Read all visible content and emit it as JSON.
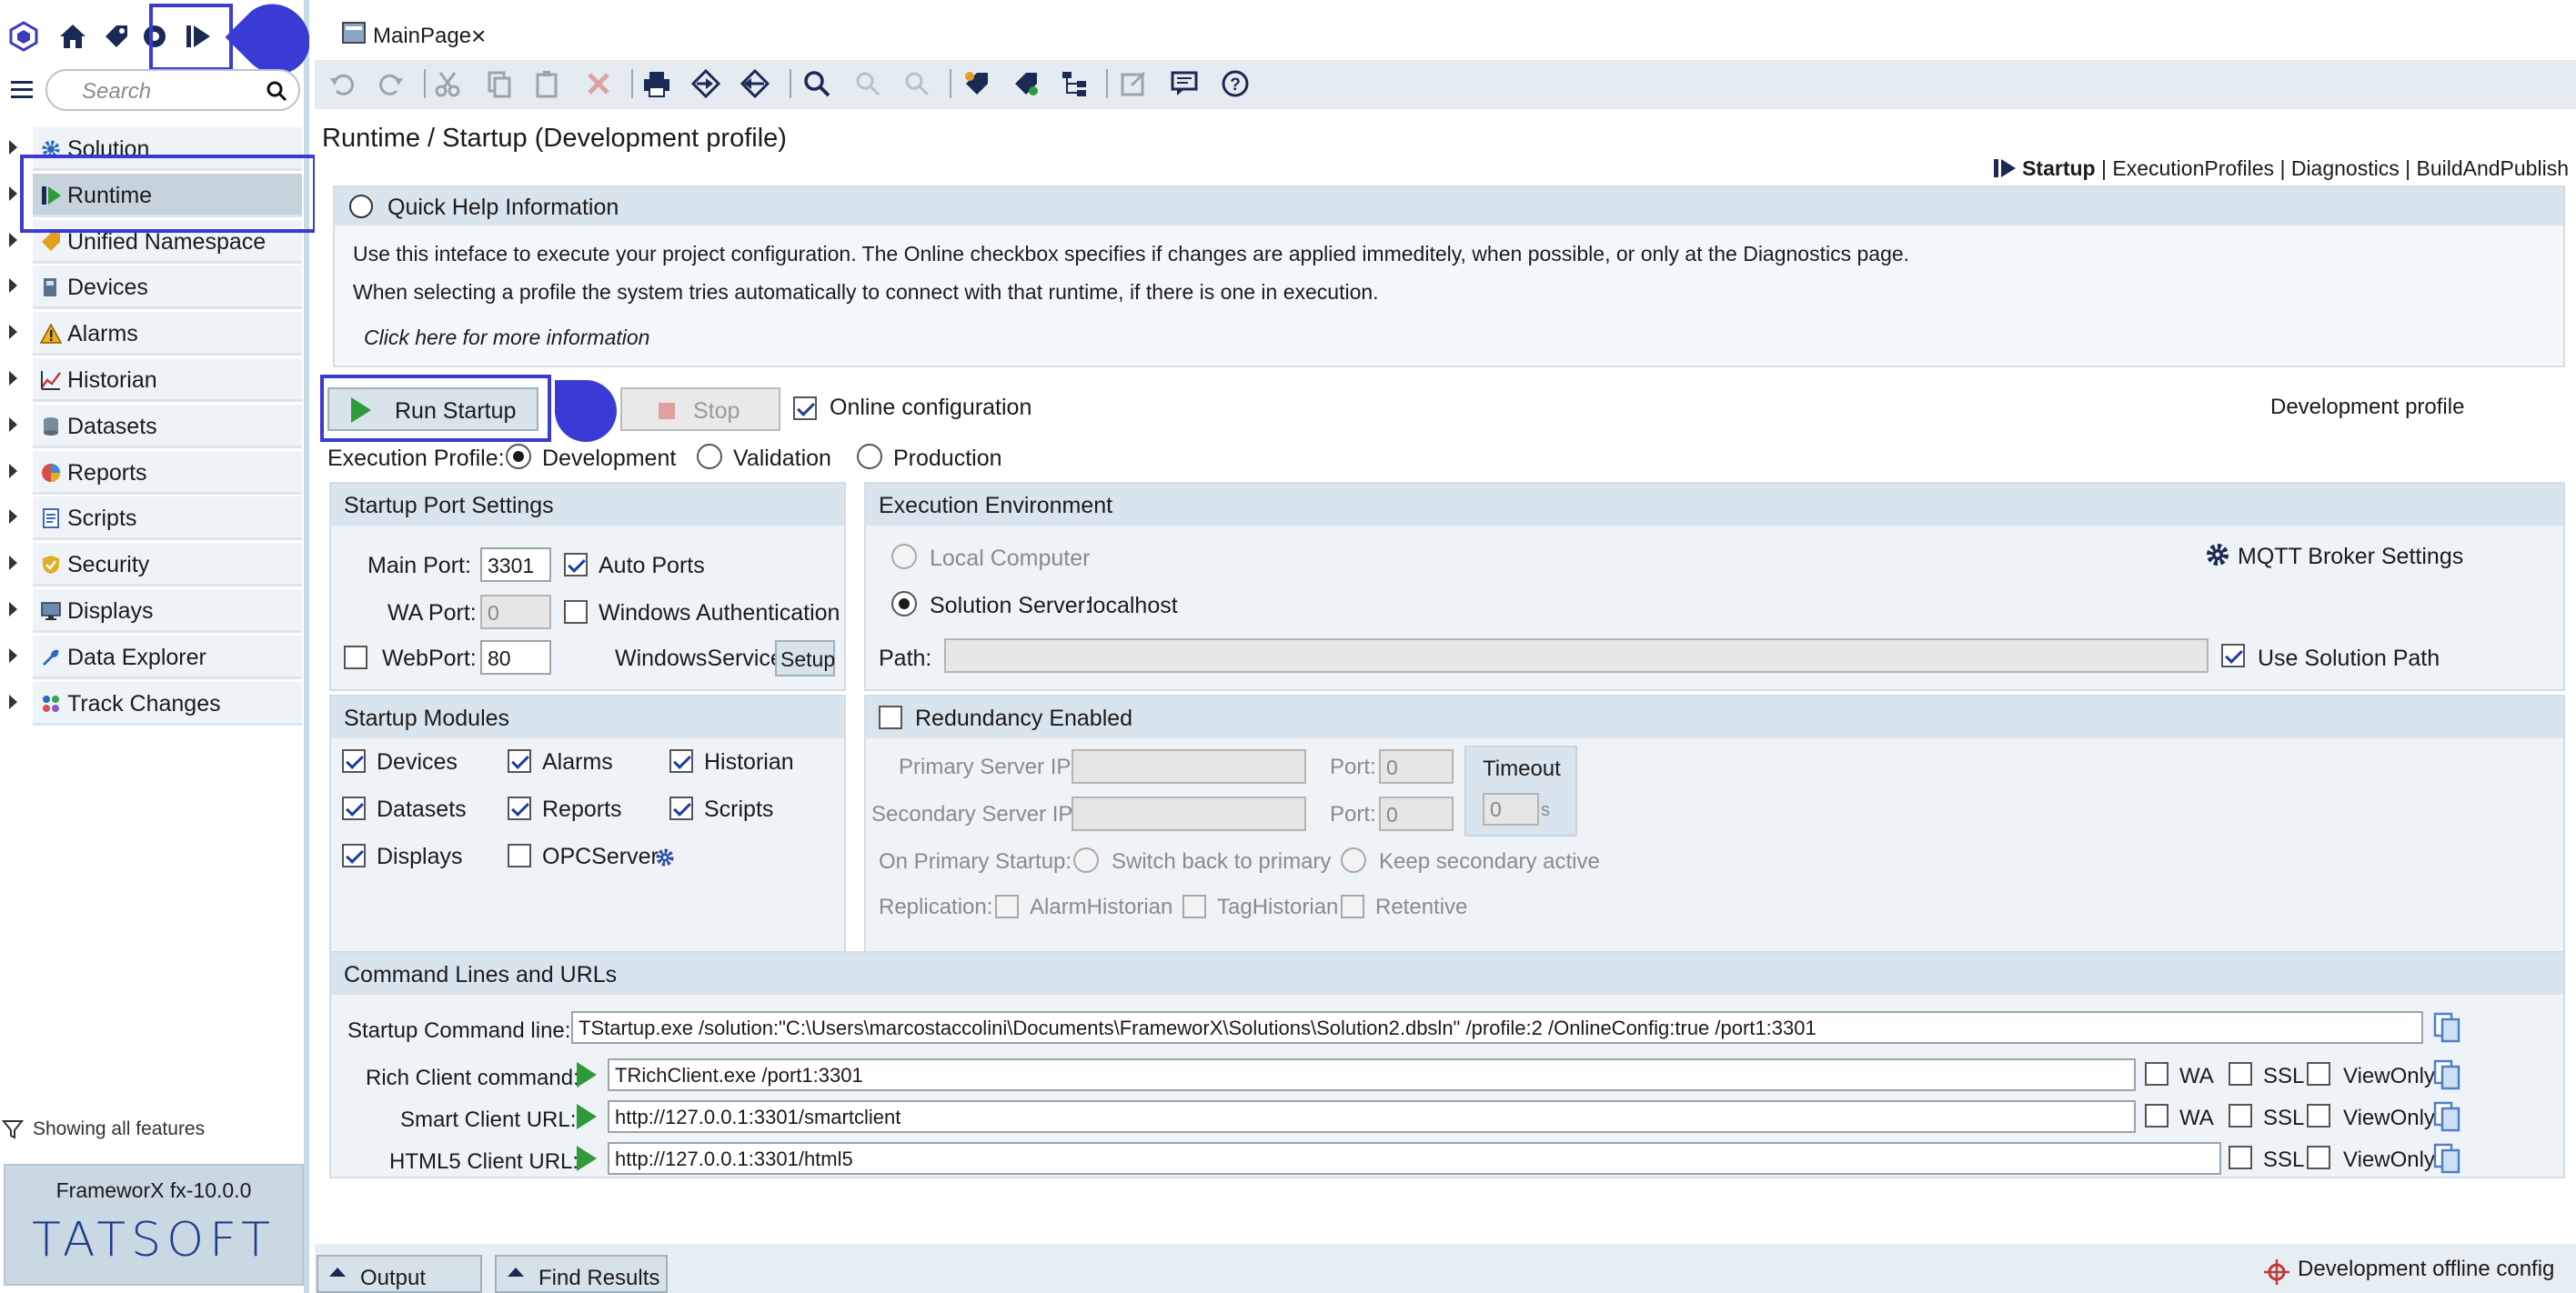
{
  "tab": {
    "title": "MainPage",
    "close": "×"
  },
  "sidebar": {
    "search_placeholder": "Search",
    "items": [
      {
        "label": "Solution",
        "icon": "gear-icon"
      },
      {
        "label": "Runtime",
        "icon": "runtime-play-icon"
      },
      {
        "label": "Unified Namespace",
        "icon": "tag-icon"
      },
      {
        "label": "Devices",
        "icon": "device-icon"
      },
      {
        "label": "Alarms",
        "icon": "warning-icon"
      },
      {
        "label": "Historian",
        "icon": "chart-line-icon"
      },
      {
        "label": "Datasets",
        "icon": "database-icon"
      },
      {
        "label": "Reports",
        "icon": "pie-chart-icon"
      },
      {
        "label": "Scripts",
        "icon": "script-icon"
      },
      {
        "label": "Security",
        "icon": "shield-icon"
      },
      {
        "label": "Displays",
        "icon": "monitor-icon"
      },
      {
        "label": "Data Explorer",
        "icon": "wrench-icon"
      },
      {
        "label": "Track Changes",
        "icon": "track-changes-icon"
      }
    ],
    "filter_text": "Showing all features",
    "version": "FrameworX fx-10.0.0",
    "logo": "TATSOFT"
  },
  "page": {
    "title": "Runtime / Startup (Development profile)",
    "nav": {
      "current": "Startup",
      "links": [
        "ExecutionProfiles",
        "Diagnostics",
        "BuildAndPublish"
      ],
      "sep": "|"
    },
    "help": {
      "title": "Quick Help Information",
      "line1": "Use this inteface to execute your project configuration. The Online checkbox specifies if changes are applied immeditely, when possible, or only at the Diagnostics page.",
      "line2": "When selecting a profile the system tries automatically to connect with that runtime, if there is one in execution.",
      "link": "Click here for more information"
    },
    "run_label": "Run Startup",
    "stop_label": "Stop",
    "online_label": "Online configuration",
    "online_checked": true,
    "profile_status": "Development profile",
    "exec_profile_label": "Execution Profile:",
    "profiles": [
      "Development",
      "Validation",
      "Production"
    ],
    "selected_profile": "Development"
  },
  "port_settings": {
    "title": "Startup Port Settings",
    "main_port_label": "Main Port:",
    "main_port": "3301",
    "auto_ports_label": "Auto Ports",
    "auto_ports": true,
    "wa_port_label": "WA Port:",
    "wa_port": "0",
    "win_auth_label": "Windows Authentication",
    "webport_label": "WebPort:",
    "webport": "80",
    "service_label": "WindowsService",
    "setup_label": "Setup"
  },
  "exec_env": {
    "title": "Execution Environment",
    "local_label": "Local Computer",
    "server_label": "Solution Server:",
    "server_value": "localhost",
    "mqtt_label": "MQTT Broker Settings",
    "path_label": "Path:",
    "path_value": "",
    "use_solution_path_label": "Use Solution Path",
    "use_solution_path": true
  },
  "modules": {
    "title": "Startup Modules",
    "items": [
      {
        "label": "Devices",
        "checked": true
      },
      {
        "label": "Alarms",
        "checked": true
      },
      {
        "label": "Historian",
        "checked": true
      },
      {
        "label": "Datasets",
        "checked": true
      },
      {
        "label": "Reports",
        "checked": true
      },
      {
        "label": "Scripts",
        "checked": true
      },
      {
        "label": "Displays",
        "checked": true
      },
      {
        "label": "OPCServer",
        "checked": false
      }
    ]
  },
  "redundancy": {
    "title": "Redundancy Enabled",
    "primary_ip_label": "Primary Server IP:",
    "secondary_ip_label": "Secondary Server IP:",
    "port_label": "Port:",
    "port1": "0",
    "port2": "0",
    "timeout_label": "Timeout",
    "timeout": "0",
    "timeout_unit": "s",
    "startup_label": "On Primary Startup:",
    "switch_label": "Switch back to primary",
    "keep_label": "Keep secondary active",
    "replication_label": "Replication:",
    "rep_items": [
      "AlarmHistorian",
      "TagHistorian",
      "Retentive"
    ]
  },
  "commands": {
    "title": "Command Lines and URLs",
    "startup_label": "Startup Command line:",
    "startup_value": "TStartup.exe /solution:\"C:\\Users\\marcostaccolini\\Documents\\FrameworX\\Solutions\\Solution2.dbsln\" /profile:2 /OnlineConfig:true /port1:3301",
    "rich_label": "Rich Client command:",
    "rich_value": "TRichClient.exe  /port1:3301",
    "smart_label": "Smart Client URL:",
    "smart_value": "http://127.0.0.1:3301/smartclient",
    "html5_label": "HTML5 Client URL:",
    "html5_value": "http://127.0.0.1:3301/html5",
    "wa": "WA",
    "ssl": "SSL",
    "viewonly": "ViewOnly"
  },
  "bottom": {
    "output": "Output",
    "find": "Find Results",
    "status": "Development offline config"
  },
  "colors": {
    "accent": "#3a3bd4",
    "header": "#d9e5ee",
    "panel": "#eef3f7",
    "play": "#2e9b3a"
  }
}
